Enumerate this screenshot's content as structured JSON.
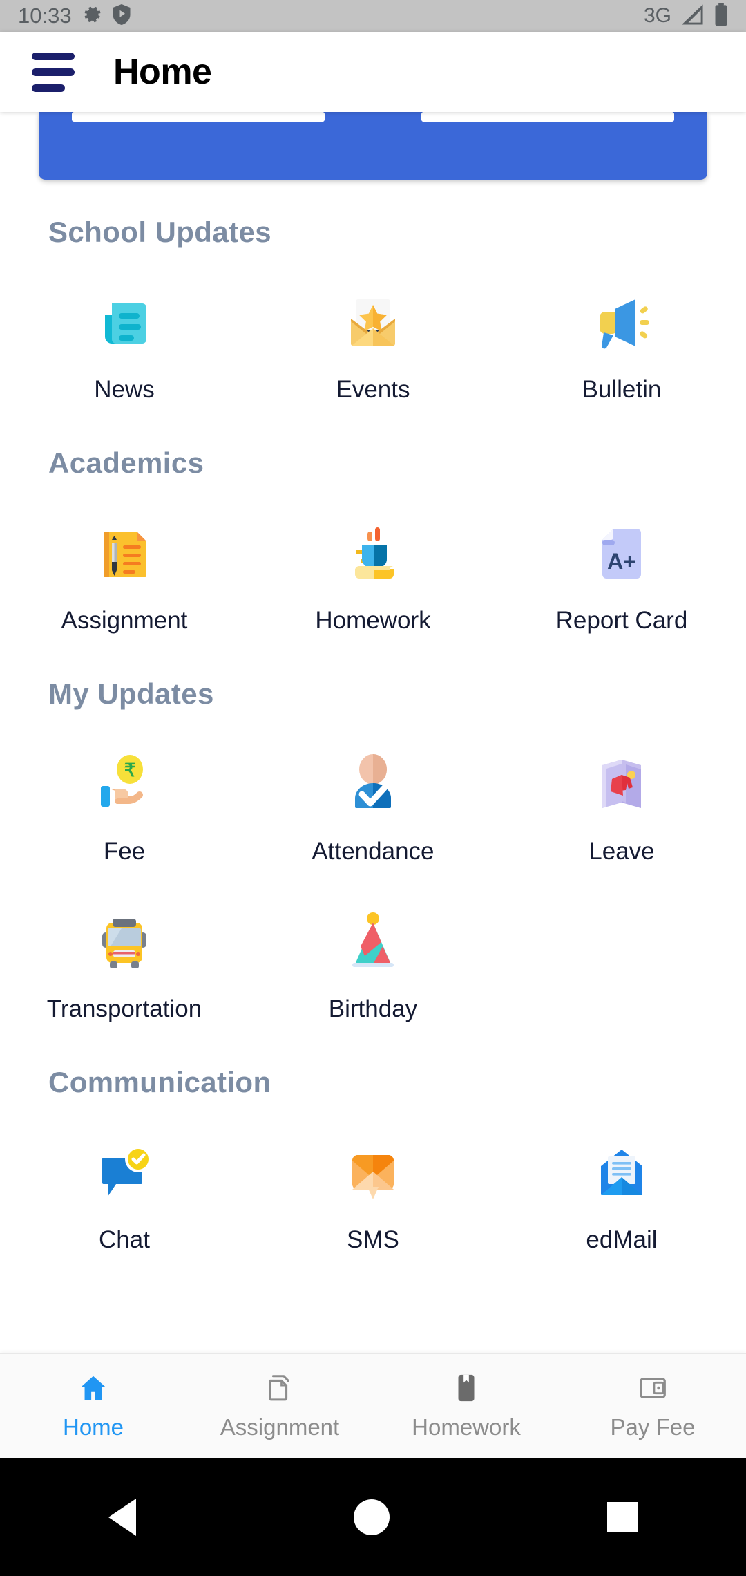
{
  "status_bar": {
    "time": "10:33",
    "network": "3G",
    "icons": [
      "gear-icon",
      "shield-play-icon",
      "signal-icon",
      "battery-icon"
    ]
  },
  "app_bar": {
    "title": "Home",
    "menu_icon": "hamburger-menu-icon"
  },
  "banner": {
    "accent_color": "#3b68d8",
    "placeholder_bar_count": 2
  },
  "sections": [
    {
      "title": "School Updates",
      "rows": [
        [
          {
            "label": "News",
            "icon": "news-document-icon"
          },
          {
            "label": "Events",
            "icon": "envelope-star-icon"
          },
          {
            "label": "Bulletin",
            "icon": "megaphone-icon"
          }
        ]
      ]
    },
    {
      "title": "Academics",
      "rows": [
        [
          {
            "label": "Assignment",
            "icon": "document-pen-icon"
          },
          {
            "label": "Homework",
            "icon": "coffee-cup-book-icon"
          },
          {
            "label": "Report Card",
            "icon": "report-card-a-plus-icon"
          }
        ]
      ]
    },
    {
      "title": "My Updates",
      "rows": [
        [
          {
            "label": "Fee",
            "icon": "hand-rupee-coin-icon"
          },
          {
            "label": "Attendance",
            "icon": "person-check-icon"
          },
          {
            "label": "Leave",
            "icon": "open-door-exit-icon"
          }
        ],
        [
          {
            "label": "Transportation",
            "icon": "school-bus-icon"
          },
          {
            "label": "Birthday",
            "icon": "party-hat-icon"
          },
          {
            "label": "",
            "icon": ""
          }
        ]
      ]
    },
    {
      "title": "Communication",
      "rows": [
        [
          {
            "label": "Chat",
            "icon": "chat-bubble-check-icon"
          },
          {
            "label": "SMS",
            "icon": "sms-envelope-icon"
          },
          {
            "label": "edMail",
            "icon": "open-mail-icon"
          }
        ]
      ]
    }
  ],
  "bottom_nav": {
    "active_color": "#2196f3",
    "inactive_color": "#8c8c8c",
    "items": [
      {
        "label": "Home",
        "icon": "home-icon",
        "active": true
      },
      {
        "label": "Assignment",
        "icon": "copy-page-icon",
        "active": false
      },
      {
        "label": "Homework",
        "icon": "bookmark-book-icon",
        "active": false
      },
      {
        "label": "Pay Fee",
        "icon": "wallet-card-icon",
        "active": false
      }
    ]
  },
  "android_nav": {
    "buttons": [
      "back-triangle-icon",
      "home-circle-icon",
      "recents-square-icon"
    ]
  }
}
